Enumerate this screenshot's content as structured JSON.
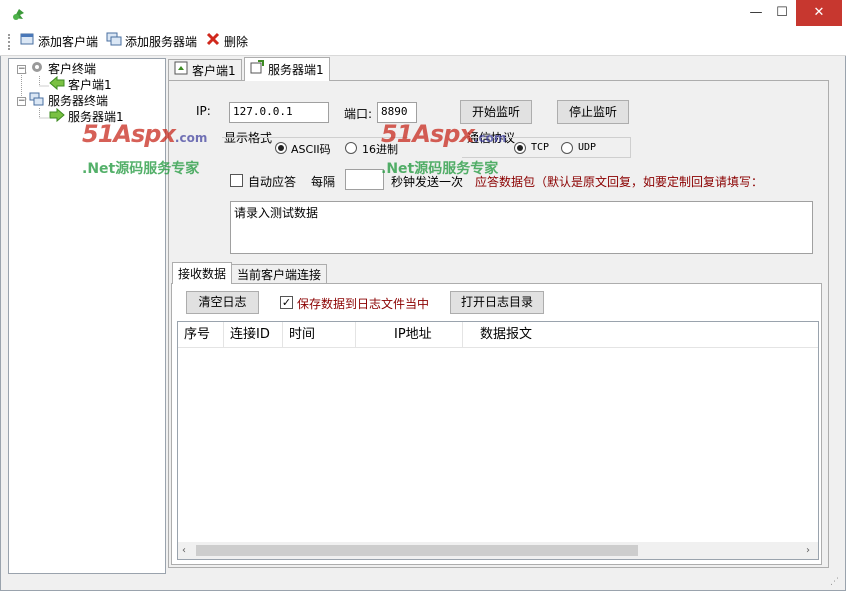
{
  "titlebar": {
    "minimize_label": "—",
    "maximize_label": "☐",
    "close_label": "✕"
  },
  "toolbar": {
    "add_client_label": "添加客户端",
    "add_server_label": "添加服务器端",
    "delete_label": "删除"
  },
  "tree": {
    "client_group": "客户终端",
    "client_item": "客户端1",
    "server_group": "服务器终端",
    "server_item": "服务器端1"
  },
  "tabs": {
    "client_tab": "客户端1",
    "server_tab": "服务器端1"
  },
  "server": {
    "ip_label": "IP:",
    "ip_value": "127.0.0.1",
    "port_label": "端口:",
    "port_value": "8890",
    "start_label": "开始监听",
    "stop_label": "停止监听",
    "display_format_label": "显示格式",
    "ascii_label": "ASCII码",
    "hex_label": "16进制",
    "protocol_label": "通信协议",
    "tcp_label": "TCP",
    "udp_label": "UDP",
    "auto_reply_label": "自动应答",
    "every_label": "每隔",
    "interval_value": "",
    "seconds_label": "秒钟发送一次",
    "reply_hint": "应答数据包（默认是原文回复，如要定制回复请填写：",
    "test_data_text": "请录入测试数据"
  },
  "bottom_tabs": {
    "receive_tab": "接收数据",
    "connections_tab": "当前客户端连接"
  },
  "log": {
    "clear_label": "清空日志",
    "save_label": "保存数据到日志文件当中",
    "save_checked": true,
    "open_dir_label": "打开日志目录"
  },
  "grid": {
    "columns": [
      "序号",
      "连接ID",
      "时间",
      "IP地址",
      "数据报文"
    ]
  },
  "watermark": {
    "logo_main": "51Aspx",
    "logo_suffix": ".com",
    "tagline": ".Net源码服务专家"
  },
  "colors": {
    "close_red": "#c7372f",
    "hint_red": "#8b0000",
    "watermark_red": "#c92b1f",
    "watermark_green": "#2a9d45"
  }
}
